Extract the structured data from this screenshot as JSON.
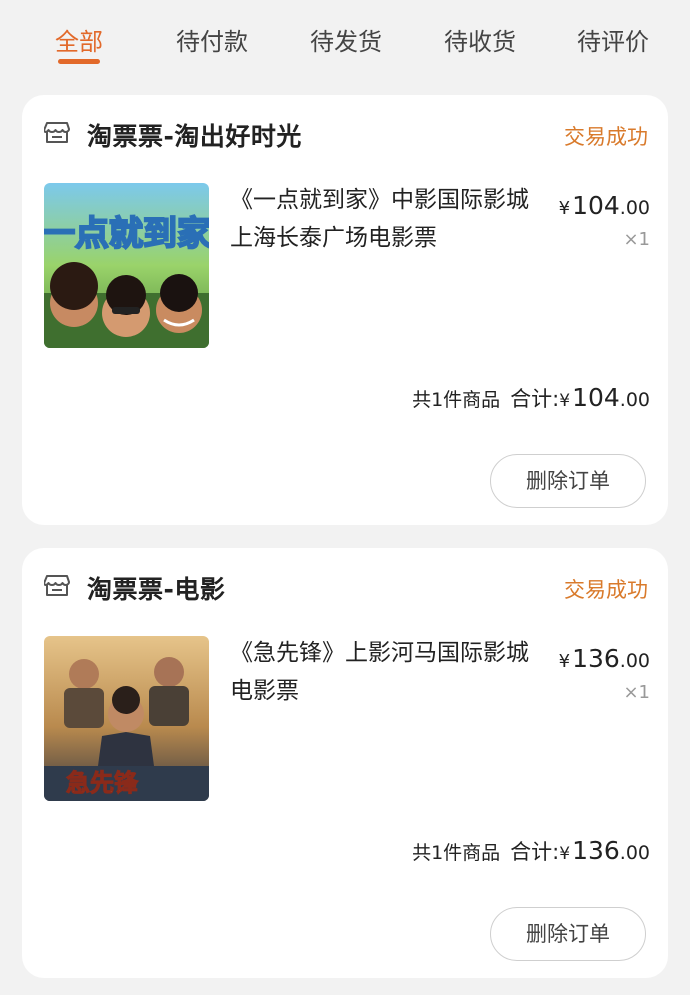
{
  "tabs": [
    {
      "label": "全部",
      "active": true
    },
    {
      "label": "待付款"
    },
    {
      "label": "待发货"
    },
    {
      "label": "待收货"
    },
    {
      "label": "待评价"
    }
  ],
  "orders": [
    {
      "shop": "淘票票-淘出好时光",
      "status": "交易成功",
      "poster_text": "一点就到家",
      "title": "《一点就到家》中影国际影城上海长泰广场电影票",
      "price_symbol": "¥",
      "price_int": "104",
      "price_dec": ".00",
      "quantity": "×1",
      "item_count": "共1件商品",
      "total_label": "合计:",
      "total_symbol": "¥",
      "total_int": "104",
      "total_dec": ".00",
      "action": "删除订单"
    },
    {
      "shop": "淘票票-电影",
      "status": "交易成功",
      "poster_text": "急先锋",
      "title": "《急先锋》上影河马国际影城电影票",
      "price_symbol": "¥",
      "price_int": "136",
      "price_dec": ".00",
      "quantity": "×1",
      "item_count": "共1件商品",
      "total_label": "合计:",
      "total_symbol": "¥",
      "total_int": "136",
      "total_dec": ".00",
      "action": "删除订单"
    }
  ],
  "colors": {
    "accent": "#e2692a",
    "status": "#d97a2b",
    "background": "#f2f2f2"
  }
}
